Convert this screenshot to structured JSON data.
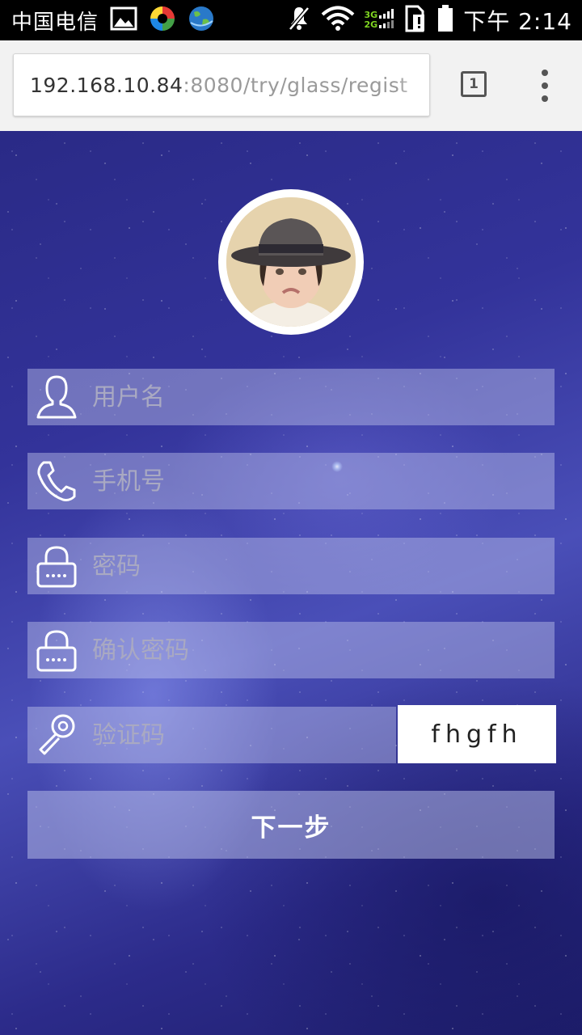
{
  "status_bar": {
    "carrier": "中国电信",
    "network_labels": [
      "3G",
      "2G"
    ],
    "time": "下午 2:14",
    "icons": [
      "gallery-icon",
      "app-icon",
      "browser-globe-icon",
      "mute-icon",
      "wifi-icon",
      "signal-icon",
      "sim-alert-icon",
      "battery-icon"
    ]
  },
  "browser": {
    "url_host": "192.168.10.84",
    "url_path": ":8080/try/glass/regist",
    "tab_count": "1",
    "menu_icon": "overflow-menu-icon"
  },
  "form": {
    "avatar_icon": "avatar-photo",
    "fields": [
      {
        "placeholder": "用户名",
        "icon": "user-icon",
        "value": ""
      },
      {
        "placeholder": "手机号",
        "icon": "phone-icon",
        "value": ""
      },
      {
        "placeholder": "密码",
        "icon": "lock-icon",
        "value": ""
      },
      {
        "placeholder": "确认密码",
        "icon": "lock-icon",
        "value": ""
      },
      {
        "placeholder": "验证码",
        "icon": "key-icon",
        "value": ""
      }
    ],
    "captcha_text": "fhgfh",
    "submit_label": "下一步"
  },
  "colors": {
    "status_bar_bg": "#000000",
    "browser_bar_bg": "#f2f2f2",
    "field_bg": "rgba(190,195,235,0.45)",
    "placeholder": "#a9a9c2",
    "network_green": "#7ed321"
  }
}
